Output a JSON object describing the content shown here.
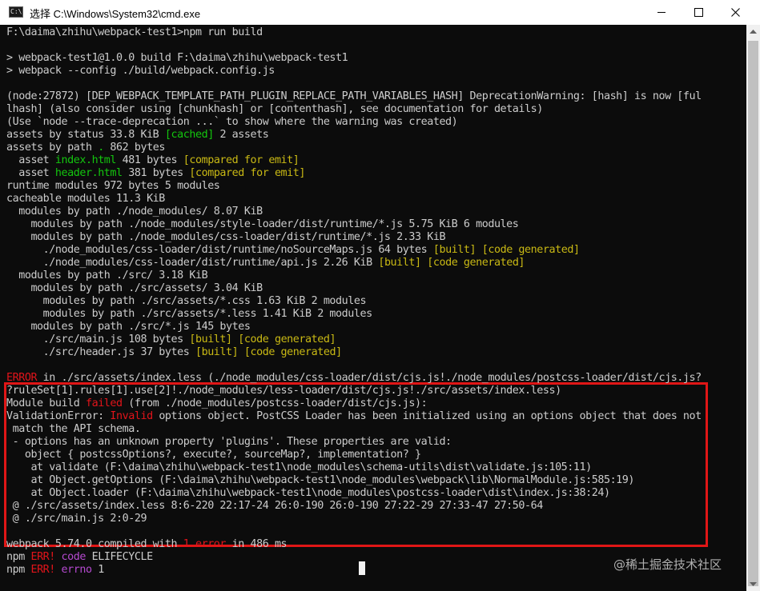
{
  "window": {
    "title": "选择 C:\\Windows\\System32\\cmd.exe",
    "app_icon_glyph": "C:\\"
  },
  "console": {
    "lines": [
      [
        {
          "t": "F:\\daima\\zhihu\\webpack-test1>npm run build",
          "c": "def"
        }
      ],
      [],
      [
        {
          "t": "> webpack-test1@1.0.0 build F:\\daima\\zhihu\\webpack-test1",
          "c": "def"
        }
      ],
      [
        {
          "t": "> webpack --config ./build/webpack.config.js",
          "c": "def"
        }
      ],
      [],
      [
        {
          "t": "(node:27872) [DEP_WEBPACK_TEMPLATE_PATH_PLUGIN_REPLACE_PATH_VARIABLES_HASH] DeprecationWarning: [hash] is now [ful",
          "c": "def"
        }
      ],
      [
        {
          "t": "lhash] (also consider using [chunkhash] or [contenthash], see documentation for details)",
          "c": "def"
        }
      ],
      [
        {
          "t": "(Use `node --trace-deprecation ...` to show where the warning was created)",
          "c": "def"
        }
      ],
      [
        {
          "t": "assets by status 33.8 KiB ",
          "c": "def"
        },
        {
          "t": "[cached]",
          "c": "grn"
        },
        {
          "t": " 2 assets",
          "c": "def"
        }
      ],
      [
        {
          "t": "assets by path ",
          "c": "def"
        },
        {
          "t": ".",
          "c": "grn"
        },
        {
          "t": " 862 bytes",
          "c": "def"
        }
      ],
      [
        {
          "t": "  asset ",
          "c": "def"
        },
        {
          "t": "index.html",
          "c": "grn"
        },
        {
          "t": " 481 bytes ",
          "c": "def"
        },
        {
          "t": "[compared for emit]",
          "c": "yel"
        }
      ],
      [
        {
          "t": "  asset ",
          "c": "def"
        },
        {
          "t": "header.html",
          "c": "grn"
        },
        {
          "t": " 381 bytes ",
          "c": "def"
        },
        {
          "t": "[compared for emit]",
          "c": "yel"
        }
      ],
      [
        {
          "t": "runtime modules 972 bytes 5 modules",
          "c": "def"
        }
      ],
      [
        {
          "t": "cacheable modules 11.3 KiB",
          "c": "def"
        }
      ],
      [
        {
          "t": "  modules by path ./node_modules/ 8.07 KiB",
          "c": "def"
        }
      ],
      [
        {
          "t": "    modules by path ./node_modules/style-loader/dist/runtime/*.js 5.75 KiB 6 modules",
          "c": "def"
        }
      ],
      [
        {
          "t": "    modules by path ./node_modules/css-loader/dist/runtime/*.js 2.33 KiB",
          "c": "def"
        }
      ],
      [
        {
          "t": "      ./node_modules/css-loader/dist/runtime/noSourceMaps.js 64 bytes ",
          "c": "def"
        },
        {
          "t": "[built]",
          "c": "yel"
        },
        {
          "t": " ",
          "c": "def"
        },
        {
          "t": "[code generated]",
          "c": "yel"
        }
      ],
      [
        {
          "t": "      ./node_modules/css-loader/dist/runtime/api.js 2.26 KiB ",
          "c": "def"
        },
        {
          "t": "[built]",
          "c": "yel"
        },
        {
          "t": " ",
          "c": "def"
        },
        {
          "t": "[code generated]",
          "c": "yel"
        }
      ],
      [
        {
          "t": "  modules by path ./src/ 3.18 KiB",
          "c": "def"
        }
      ],
      [
        {
          "t": "    modules by path ./src/assets/ 3.04 KiB",
          "c": "def"
        }
      ],
      [
        {
          "t": "      modules by path ./src/assets/*.css 1.63 KiB 2 modules",
          "c": "def"
        }
      ],
      [
        {
          "t": "      modules by path ./src/assets/*.less 1.41 KiB 2 modules",
          "c": "def"
        }
      ],
      [
        {
          "t": "    modules by path ./src/*.js 145 bytes",
          "c": "def"
        }
      ],
      [
        {
          "t": "      ./src/main.js 108 bytes ",
          "c": "def"
        },
        {
          "t": "[built]",
          "c": "yel"
        },
        {
          "t": " ",
          "c": "def"
        },
        {
          "t": "[code generated]",
          "c": "yel"
        }
      ],
      [
        {
          "t": "      ./src/header.js 37 bytes ",
          "c": "def"
        },
        {
          "t": "[built]",
          "c": "yel"
        },
        {
          "t": " ",
          "c": "def"
        },
        {
          "t": "[code generated]",
          "c": "yel"
        }
      ],
      [],
      [
        {
          "t": "ERROR",
          "c": "red"
        },
        {
          "t": " in ./src/assets/index.less (./node_modules/css-loader/dist/cjs.js!./node_modules/postcss-loader/dist/cjs.js?",
          "c": "def"
        }
      ],
      [
        {
          "t": "?ruleSet[1].rules[1].use[2]!./node_modules/less-loader/dist/cjs.js!./src/assets/index.less)",
          "c": "def"
        }
      ],
      [
        {
          "t": "Module build ",
          "c": "def"
        },
        {
          "t": "failed",
          "c": "red"
        },
        {
          "t": " (from ./node_modules/postcss-loader/dist/cjs.js):",
          "c": "def"
        }
      ],
      [
        {
          "t": "ValidationError: ",
          "c": "def"
        },
        {
          "t": "Invalid",
          "c": "red"
        },
        {
          "t": " options object. PostCSS Loader has been initialized using an options object that does not",
          "c": "def"
        }
      ],
      [
        {
          "t": " match the API schema.",
          "c": "def"
        }
      ],
      [
        {
          "t": " - options has an unknown property 'plugins'. These properties are valid:",
          "c": "def"
        }
      ],
      [
        {
          "t": "   object { postcssOptions?, execute?, sourceMap?, implementation? }",
          "c": "def"
        }
      ],
      [
        {
          "t": "    at validate (F:\\daima\\zhihu\\webpack-test1\\node_modules\\schema-utils\\dist\\validate.js:105:11)",
          "c": "def"
        }
      ],
      [
        {
          "t": "    at Object.getOptions (F:\\daima\\zhihu\\webpack-test1\\node_modules\\webpack\\lib\\NormalModule.js:585:19)",
          "c": "def"
        }
      ],
      [
        {
          "t": "    at Object.loader (F:\\daima\\zhihu\\webpack-test1\\node_modules\\postcss-loader\\dist\\index.js:38:24)",
          "c": "def"
        }
      ],
      [
        {
          "t": " @ ./src/assets/index.less 8:6-220 22:17-24 26:0-190 26:0-190 27:22-29 27:33-47 27:50-64",
          "c": "def"
        }
      ],
      [
        {
          "t": " @ ./src/main.js 2:0-29",
          "c": "def"
        }
      ],
      [],
      [
        {
          "t": "webpack 5.74.0 compiled with ",
          "c": "def"
        },
        {
          "t": "1 error",
          "c": "red"
        },
        {
          "t": " in 486 ms",
          "c": "def"
        }
      ],
      [
        {
          "t": "npm ",
          "c": "def"
        },
        {
          "t": "ERR!",
          "c": "red"
        },
        {
          "t": " ",
          "c": "def"
        },
        {
          "t": "code",
          "c": "mag"
        },
        {
          "t": " ELIFECYCLE",
          "c": "def"
        }
      ],
      [
        {
          "t": "npm ",
          "c": "def"
        },
        {
          "t": "ERR!",
          "c": "red"
        },
        {
          "t": " ",
          "c": "def"
        },
        {
          "t": "errno",
          "c": "mag"
        },
        {
          "t": " 1",
          "c": "def"
        }
      ]
    ]
  },
  "watermark": "@稀土掘金技术社区",
  "colors": {
    "background": "#0c0c0c",
    "default_text": "#cccccc",
    "green": "#13c60e",
    "yellow": "#c9b914",
    "red": "#e2141a",
    "magenta": "#b64ad1",
    "highlight_box": "#e01616"
  }
}
